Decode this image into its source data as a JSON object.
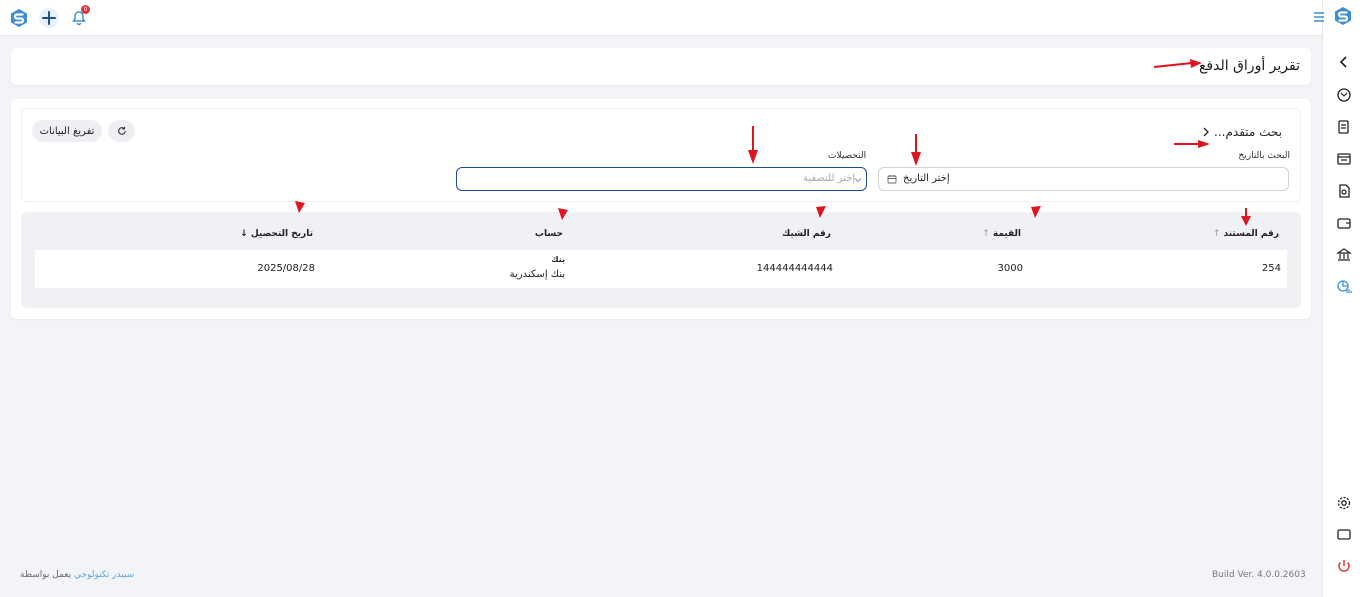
{
  "colors": {
    "accent": "#1f4e8c",
    "brand_blue": "#3a8fd6",
    "annotation_red": "#e0141e",
    "danger": "#e0303a"
  },
  "topbar": {
    "notification_count": "0",
    "icons": [
      "app-logo",
      "plus-icon",
      "bell-icon"
    ]
  },
  "sidebar": {
    "icons": [
      "menu-icon",
      "app-logo",
      "chevron-left-icon",
      "support-icon",
      "receipt-icon",
      "store-icon",
      "document-search-icon",
      "wallet-icon",
      "bank-icon",
      "report-chart-icon",
      "gear-icon",
      "monitor-icon",
      "power-icon"
    ]
  },
  "page": {
    "title": "تقرير أوراق الدفع"
  },
  "filters": {
    "advanced_search": "بحث متقدم...",
    "date_label": "البحث بالتاريخ",
    "date_placeholder": "إختر التاريخ",
    "collections_label": "التحصيلات",
    "collections_placeholder": "إختر للتصفية",
    "clear_button": "تفريغ البيانات"
  },
  "table": {
    "headers": {
      "doc_no": "رقم المستند",
      "amount": "القيمة",
      "check_no": "رقم الشيك",
      "account": "حساب",
      "collection_date": "تاريخ التحصيل"
    },
    "rows": [
      {
        "doc_no": "254",
        "amount": "3000",
        "check_no": "144444444444",
        "account_type": "بنك",
        "account_name": "بنك إسكندرية",
        "collection_date": "2025/08/28"
      }
    ]
  },
  "footer": {
    "powered_by": "يعمل بواسطة",
    "company": "سبيدر تكنولوجي",
    "build": "Build Ver. 4.0.0.2603"
  }
}
